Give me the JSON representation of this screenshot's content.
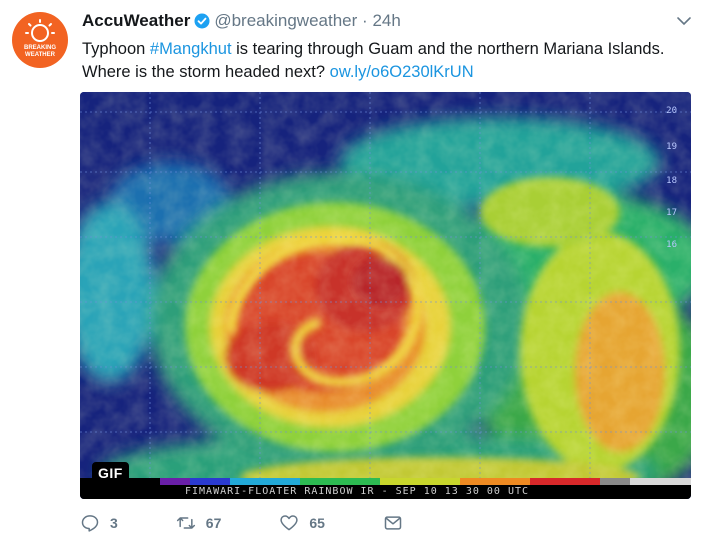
{
  "tweet": {
    "avatar_lines": [
      "BREAKING",
      "WEATHER"
    ],
    "display_name": "AccuWeather",
    "handle": "@breakingweather",
    "separator": "·",
    "time": "24h",
    "text_part1": "Typhoon ",
    "hashtag": "#Mangkhut",
    "text_part2": " is tearing through Guam and the northern Mariana Islands. Where is the storm headed next? ",
    "link": "ow.ly/o6O230lKrUN"
  },
  "media": {
    "badge": "GIF",
    "caption": "FIMAWARI-FLOATER RAINBOW IR - SEP 10 13 30 00 UTC",
    "lat_labels": [
      "20",
      "19",
      "18",
      "17",
      "16"
    ]
  },
  "actions": {
    "replies": "3",
    "retweets": "67",
    "likes": "65"
  },
  "colors": {
    "brand": "#f26322",
    "link": "#1b95e0",
    "muted": "#657786",
    "verified": "#1da1f2"
  }
}
